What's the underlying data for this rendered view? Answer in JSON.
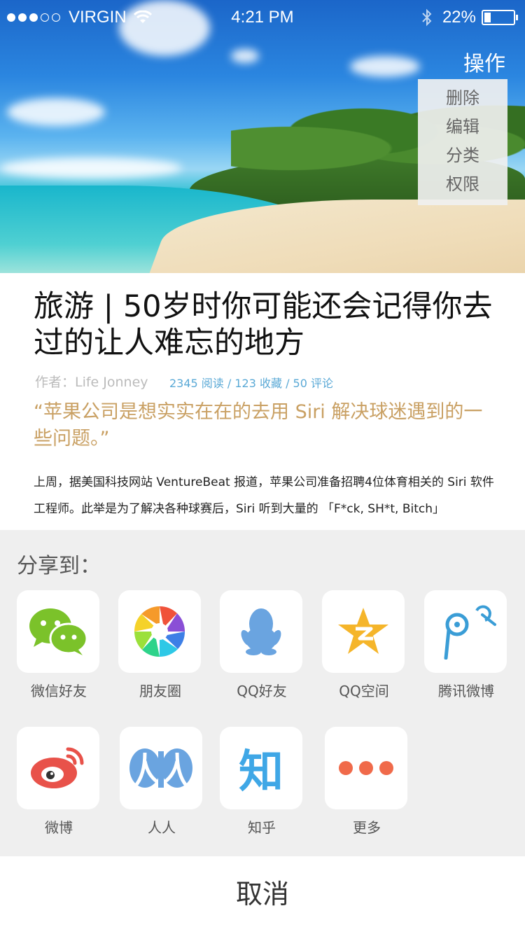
{
  "status_bar": {
    "carrier": "VIRGIN",
    "time": "4:21 PM",
    "battery": "22%",
    "battery_level": 0.22
  },
  "operate_menu": {
    "title": "操作",
    "items": [
      "删除",
      "编辑",
      "分类",
      "权限"
    ]
  },
  "article": {
    "title": "旅游 | 50岁时你可能还会记得你去过的让人难忘的地方",
    "author": "作者：Life Jonney",
    "stats": "2345 阅读  / 123 收藏  /  50 评论",
    "quote": "“苹果公司是想实实在在的去用 Siri 解决球迷遇到的一些问题。”",
    "body": "上周，据美国科技网站 VentureBeat 报道，苹果公司准备招聘4位体育相关的 Siri 软件工程师。此举是为了解决各种球赛后，Siri 听到大量的 「F*ck, SH*t, Bitch」"
  },
  "share": {
    "title": "分享到：",
    "items": [
      {
        "label": "微信好友",
        "icon": "wechat-icon"
      },
      {
        "label": "朋友圈",
        "icon": "moments-icon"
      },
      {
        "label": "QQ好友",
        "icon": "qq-icon"
      },
      {
        "label": "QQ空间",
        "icon": "qzone-icon"
      },
      {
        "label": "腾讯微博",
        "icon": "tencent-weibo-icon"
      },
      {
        "label": "微博",
        "icon": "weibo-icon"
      },
      {
        "label": "人人",
        "icon": "renren-icon"
      },
      {
        "label": "知乎",
        "icon": "zhihu-icon"
      },
      {
        "label": "更多",
        "icon": "more-icon"
      }
    ],
    "cancel": "取消"
  },
  "colors": {
    "accent_blue": "#5aa9d6",
    "quote_gold": "#c9a063",
    "sheet_bg": "#efefef"
  }
}
